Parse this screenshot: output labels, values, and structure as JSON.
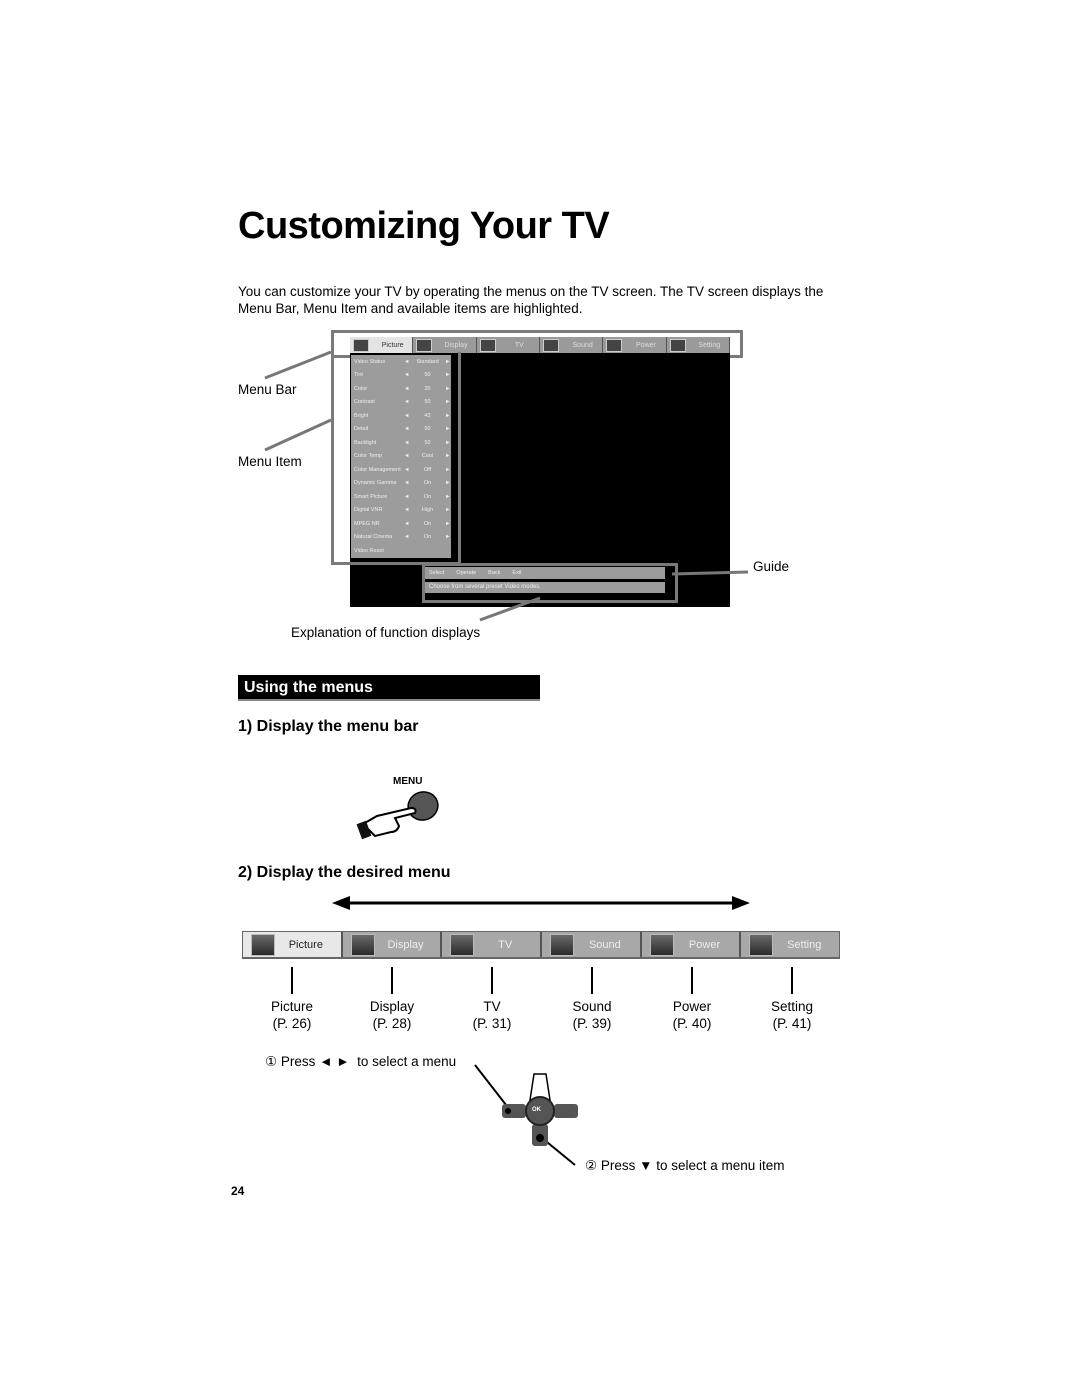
{
  "page": {
    "title": "Customizing Your TV",
    "intro": "You can customize your TV by operating the menus on the TV screen.  The TV screen displays the Menu Bar, Menu Item and available items are highlighted.",
    "page_number": "24"
  },
  "diagram": {
    "callouts": {
      "menu_bar": "Menu Bar",
      "menu_item": "Menu Item",
      "guide": "Guide",
      "explanation": "Explanation of function displays"
    },
    "tv_menubar": [
      {
        "label": "Picture",
        "icon": "picture-icon",
        "active": true
      },
      {
        "label": "Display",
        "icon": "display-icon",
        "active": false
      },
      {
        "label": "TV",
        "icon": "tv-icon",
        "active": false
      },
      {
        "label": "Sound",
        "icon": "music-note-icon",
        "active": false
      },
      {
        "label": "Power",
        "icon": "power-plug-icon",
        "active": false
      },
      {
        "label": "Setting",
        "icon": "wrench-icon",
        "active": false
      }
    ],
    "tv_menu_items": [
      {
        "name": "Video Status",
        "value": "Standard"
      },
      {
        "name": "Tint",
        "value": "50"
      },
      {
        "name": "Color",
        "value": "35"
      },
      {
        "name": "Contrast",
        "value": "50"
      },
      {
        "name": "Bright",
        "value": "43"
      },
      {
        "name": "Detail",
        "value": "50"
      },
      {
        "name": "Backlight",
        "value": "50"
      },
      {
        "name": "Color Temp",
        "value": "Cool"
      },
      {
        "name": "Color Management",
        "value": "Off"
      },
      {
        "name": "Dynamic Gamma",
        "value": "On"
      },
      {
        "name": "Smart Picture",
        "value": "On"
      },
      {
        "name": "Digital VNR",
        "value": "High"
      },
      {
        "name": "MPEG NR",
        "value": "On"
      },
      {
        "name": "Natural Cinema",
        "value": "On"
      },
      {
        "name": "Video Reset",
        "value": ""
      }
    ],
    "guide": {
      "select": "Select",
      "operate": "Operate",
      "back": "Back",
      "exit": "Exit",
      "explanation": "Choose from several preset Video modes."
    }
  },
  "section": {
    "heading": "Using the menus",
    "step1": "1)  Display the menu bar",
    "menu_button_label": "MENU",
    "step2": "2)  Display the desired menu"
  },
  "menubar": {
    "tabs": [
      {
        "label": "Picture",
        "icon": "picture-icon",
        "active": true,
        "page": "(P. 26)"
      },
      {
        "label": "Display",
        "icon": "display-icon",
        "active": false,
        "page": "(P. 28)"
      },
      {
        "label": "TV",
        "icon": "tv-icon",
        "active": false,
        "page": "(P. 31)"
      },
      {
        "label": "Sound",
        "icon": "music-note-icon",
        "active": false,
        "page": "(P. 39)"
      },
      {
        "label": "Power",
        "icon": "power-plug-icon",
        "active": false,
        "page": "(P. 40)"
      },
      {
        "label": "Setting",
        "icon": "wrench-icon",
        "active": false,
        "page": "(P. 41)"
      }
    ]
  },
  "instructions": {
    "press_lr": "① Press ◄ ►  to select a menu",
    "press_down": "② Press ▼ to select a menu item",
    "ok_label": "OK"
  }
}
